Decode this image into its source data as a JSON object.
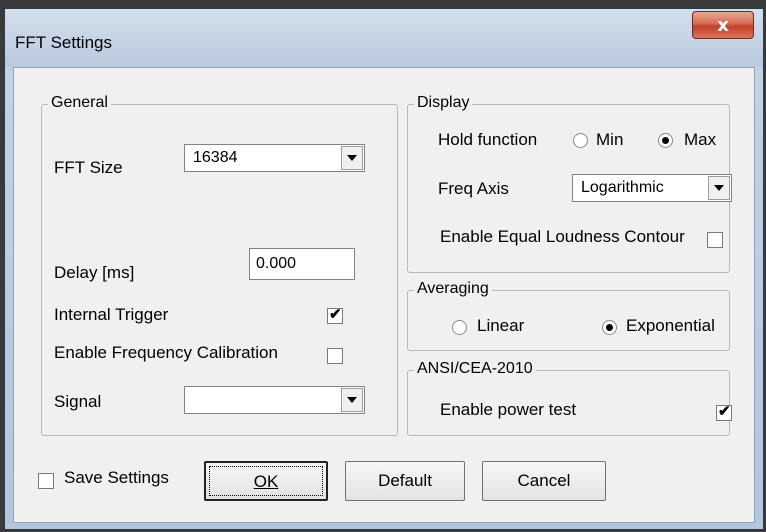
{
  "window": {
    "title": "FFT Settings",
    "close_glyph": "x"
  },
  "general": {
    "legend": "General",
    "fft_size_label": "FFT Size",
    "fft_size_value": "16384",
    "delay_label": "Delay [ms]",
    "delay_value": "0.000",
    "internal_trigger_label": "Internal Trigger",
    "internal_trigger_checked": true,
    "enable_freq_cal_label": "Enable Frequency Calibration",
    "enable_freq_cal_checked": false,
    "signal_label": "Signal",
    "signal_value": ""
  },
  "display": {
    "legend": "Display",
    "hold_function_label": "Hold function",
    "hold_min_label": "Min",
    "hold_max_label": "Max",
    "hold_selected": "Max",
    "freq_axis_label": "Freq Axis",
    "freq_axis_value": "Logarithmic",
    "equal_loudness_label": "Enable Equal Loudness Contour",
    "equal_loudness_checked": false
  },
  "averaging": {
    "legend": "Averaging",
    "linear_label": "Linear",
    "exponential_label": "Exponential",
    "selected": "Exponential"
  },
  "ansi": {
    "legend": "ANSI/CEA-2010",
    "power_test_label": "Enable power test",
    "power_test_checked": true
  },
  "footer": {
    "save_settings_label": "Save Settings",
    "save_settings_checked": false,
    "ok_label": "OK",
    "default_label": "Default",
    "cancel_label": "Cancel"
  },
  "check_glyph": "✔"
}
